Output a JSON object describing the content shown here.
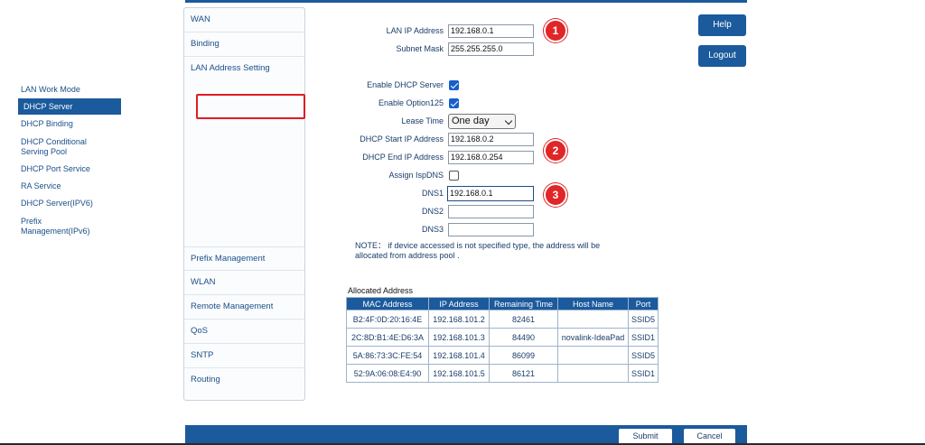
{
  "sidebar": {
    "items": [
      {
        "label": "WAN"
      },
      {
        "label": "Binding"
      },
      {
        "label": "LAN Address Setting"
      },
      {
        "label": "Prefix Management"
      },
      {
        "label": "WLAN"
      },
      {
        "label": "Remote Management"
      },
      {
        "label": "QoS"
      },
      {
        "label": "SNTP"
      },
      {
        "label": "Routing"
      }
    ],
    "sub_items": [
      {
        "label": "LAN Work Mode"
      },
      {
        "label": "DHCP Server",
        "active": true
      },
      {
        "label": "DHCP Binding"
      },
      {
        "label": "DHCP Conditional Serving Pool"
      },
      {
        "label": "DHCP Port Service"
      },
      {
        "label": "RA Service"
      },
      {
        "label": "DHCP Server(IPV6)"
      },
      {
        "label": "Prefix Management(IPv6)"
      }
    ]
  },
  "form": {
    "lan_ip_label": "LAN IP Address",
    "lan_ip_value": "192.168.0.1",
    "subnet_label": "Subnet Mask",
    "subnet_value": "255.255.255.0",
    "enable_dhcp_label": "Enable DHCP Server",
    "enable_dhcp_checked": true,
    "option125_label": "Enable Option125",
    "option125_checked": true,
    "lease_label": "Lease Time",
    "lease_value": "One day",
    "start_ip_label": "DHCP Start IP Address",
    "start_ip_value": "192.168.0.2",
    "end_ip_label": "DHCP End IP Address",
    "end_ip_value": "192.168.0.254",
    "isp_dns_label": "Assign IspDNS",
    "isp_dns_checked": false,
    "dns1_label": "DNS1",
    "dns1_value": "192.168.0.1",
    "dns2_label": "DNS2",
    "dns2_value": "",
    "dns3_label": "DNS3",
    "dns3_value": "",
    "note": "NOTE： if device accessed is not specified type, the address will be allocated from address pool ."
  },
  "annotations": {
    "badge1": "1",
    "badge2": "2",
    "badge3": "3",
    "highlight_color": "#e11b22"
  },
  "side_buttons": {
    "help": "Help",
    "logout": "Logout"
  },
  "allocated": {
    "title": "Allocated Address",
    "columns": [
      "MAC Address",
      "IP Address",
      "Remaining Time",
      "Host Name",
      "Port"
    ],
    "rows": [
      [
        "B2:4F:0D:20:16:4E",
        "192.168.101.2",
        "82461",
        "",
        "SSID5"
      ],
      [
        "2C:8D:B1:4E:D6:3A",
        "192.168.101.3",
        "84490",
        "novalink-IdeaPad",
        "SSID1"
      ],
      [
        "5A:86:73:3C:FE:54",
        "192.168.101.4",
        "86099",
        "",
        "SSID5"
      ],
      [
        "52:9A:06:08:E4:90",
        "192.168.101.5",
        "86121",
        "",
        "SSID1"
      ]
    ]
  },
  "footer": {
    "submit": "Submit",
    "cancel": "Cancel"
  },
  "colors": {
    "brand": "#1b5a9c",
    "badge": "#e02626"
  }
}
